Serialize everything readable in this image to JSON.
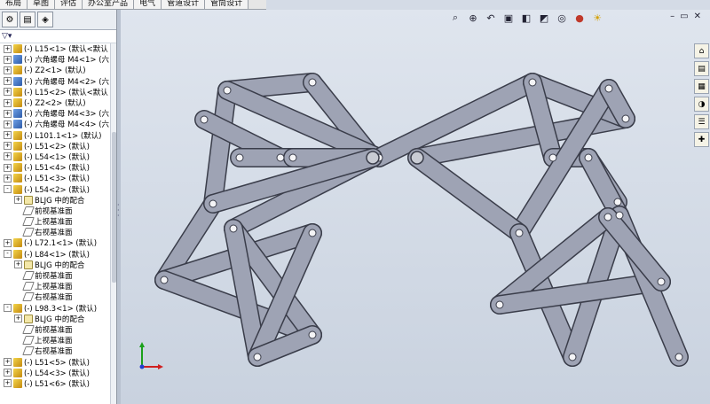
{
  "menu_tabs": [
    "布局",
    "草图",
    "评估",
    "办公室产品",
    "电气",
    "管道设计",
    "管筒设计"
  ],
  "panel": {
    "tabs": [
      "feature-manager",
      "property-manager",
      "configuration-manager"
    ],
    "filter_icon": "filter-icon"
  },
  "tree": [
    {
      "level": 0,
      "exp": "+",
      "icon": "part",
      "label": "(-) L15<1> (默认<默认"
    },
    {
      "level": 0,
      "exp": "+",
      "icon": "nut",
      "label": "(-) 六角螺母 M4<1> (六"
    },
    {
      "level": 0,
      "exp": "+",
      "icon": "part",
      "label": "(-) Z2<1> (默认)"
    },
    {
      "level": 0,
      "exp": "+",
      "icon": "nut",
      "label": "(-) 六角螺母 M4<2> (六"
    },
    {
      "level": 0,
      "exp": "+",
      "icon": "part",
      "label": "(-) L15<2> (默认<默认"
    },
    {
      "level": 0,
      "exp": "+",
      "icon": "part",
      "label": "(-) Z2<2> (默认)"
    },
    {
      "level": 0,
      "exp": "+",
      "icon": "nut",
      "label": "(-) 六角螺母 M4<3> (六"
    },
    {
      "level": 0,
      "exp": "+",
      "icon": "nut",
      "label": "(-) 六角螺母 M4<4> (六"
    },
    {
      "level": 0,
      "exp": "+",
      "icon": "part",
      "label": "(-) L101.1<1> (默认)"
    },
    {
      "level": 0,
      "exp": "+",
      "icon": "part",
      "label": "(-) L51<2> (默认)"
    },
    {
      "level": 0,
      "exp": "+",
      "icon": "part",
      "label": "(-) L54<1> (默认)"
    },
    {
      "level": 0,
      "exp": "+",
      "icon": "part",
      "label": "(-) L51<4> (默认)"
    },
    {
      "level": 0,
      "exp": "+",
      "icon": "part",
      "label": "(-) L51<3> (默认)"
    },
    {
      "level": 0,
      "exp": "-",
      "icon": "part",
      "label": "(-) L54<2> (默认)"
    },
    {
      "level": 1,
      "exp": "+",
      "icon": "mate",
      "label": "BLJG 中的配合"
    },
    {
      "level": 1,
      "exp": "",
      "icon": "plane",
      "label": "前视基准面"
    },
    {
      "level": 1,
      "exp": "",
      "icon": "plane",
      "label": "上视基准面"
    },
    {
      "level": 1,
      "exp": "",
      "icon": "plane",
      "label": "右视基准面"
    },
    {
      "level": 0,
      "exp": "+",
      "icon": "part",
      "label": "(-) L72.1<1> (默认)"
    },
    {
      "level": 0,
      "exp": "-",
      "icon": "part",
      "label": "(-) L84<1> (默认)"
    },
    {
      "level": 1,
      "exp": "+",
      "icon": "mate",
      "label": "BLJG 中的配合"
    },
    {
      "level": 1,
      "exp": "",
      "icon": "plane",
      "label": "前视基准面"
    },
    {
      "level": 1,
      "exp": "",
      "icon": "plane",
      "label": "上视基准面"
    },
    {
      "level": 1,
      "exp": "",
      "icon": "plane",
      "label": "右视基准面"
    },
    {
      "level": 0,
      "exp": "-",
      "icon": "part",
      "label": "(-) L98.3<1> (默认)"
    },
    {
      "level": 1,
      "exp": "+",
      "icon": "mate",
      "label": "BLJG 中的配合"
    },
    {
      "level": 1,
      "exp": "",
      "icon": "plane",
      "label": "前视基准面"
    },
    {
      "level": 1,
      "exp": "",
      "icon": "plane",
      "label": "上视基准面"
    },
    {
      "level": 1,
      "exp": "",
      "icon": "plane",
      "label": "右视基准面"
    },
    {
      "level": 0,
      "exp": "+",
      "icon": "part",
      "label": "(-) L51<5> (默认)"
    },
    {
      "level": 0,
      "exp": "+",
      "icon": "part",
      "label": "(-) L54<3> (默认)"
    },
    {
      "level": 0,
      "exp": "+",
      "icon": "part",
      "label": "(-) L51<6> (默认)"
    }
  ],
  "view_toolbar": [
    "zoom-to-fit-icon",
    "zoom-area-icon",
    "previous-view-icon",
    "section-view-icon",
    "view-orientation-icon",
    "display-style-icon",
    "hide-show-icon",
    "edit-appearance-icon",
    "apply-scene-icon"
  ],
  "window_controls": [
    "minimize-icon",
    "restore-icon",
    "close-icon"
  ],
  "right_strip": [
    "design-library-icon",
    "file-explorer-icon",
    "view-palette-icon",
    "appearances-icon",
    "custom-properties-icon",
    "toolbox-icon"
  ],
  "colors": {
    "viewport_top": "#dfe5ee",
    "link_fill": "#9ea3b4",
    "link_stroke": "#3a3d4a"
  }
}
